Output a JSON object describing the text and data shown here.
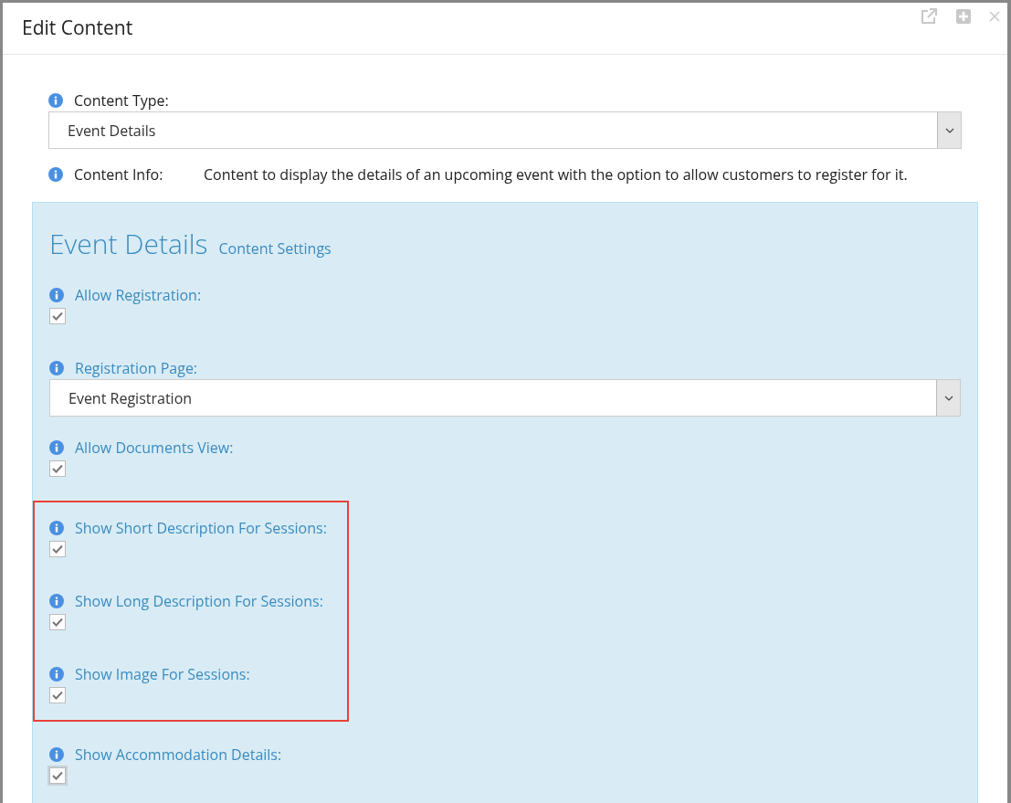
{
  "window": {
    "title": "Edit Content"
  },
  "content_type": {
    "label": "Content Type:",
    "value": "Event Details"
  },
  "content_info": {
    "label": "Content Info:",
    "text": "Content to display the details of an upcoming event with the option to allow customers to register for it."
  },
  "panel": {
    "title": "Event Details",
    "subtitle": "Content Settings",
    "settings": [
      {
        "kind": "checkbox",
        "label": "Allow Registration:",
        "checked": true,
        "focused": false
      },
      {
        "kind": "select",
        "label": "Registration Page:",
        "value": "Event Registration"
      },
      {
        "kind": "checkbox",
        "label": "Allow Documents View:",
        "checked": true,
        "focused": false
      },
      {
        "kind": "group",
        "highlighted": true,
        "children": [
          {
            "kind": "checkbox",
            "label": "Show Short Description For Sessions:",
            "checked": true,
            "focused": false
          },
          {
            "kind": "checkbox",
            "label": "Show Long Description For Sessions:",
            "checked": true,
            "focused": false
          },
          {
            "kind": "checkbox",
            "label": "Show Image For Sessions:",
            "checked": true,
            "focused": false
          }
        ]
      },
      {
        "kind": "checkbox",
        "label": "Show Accommodation Details:",
        "checked": true,
        "focused": true
      }
    ]
  }
}
